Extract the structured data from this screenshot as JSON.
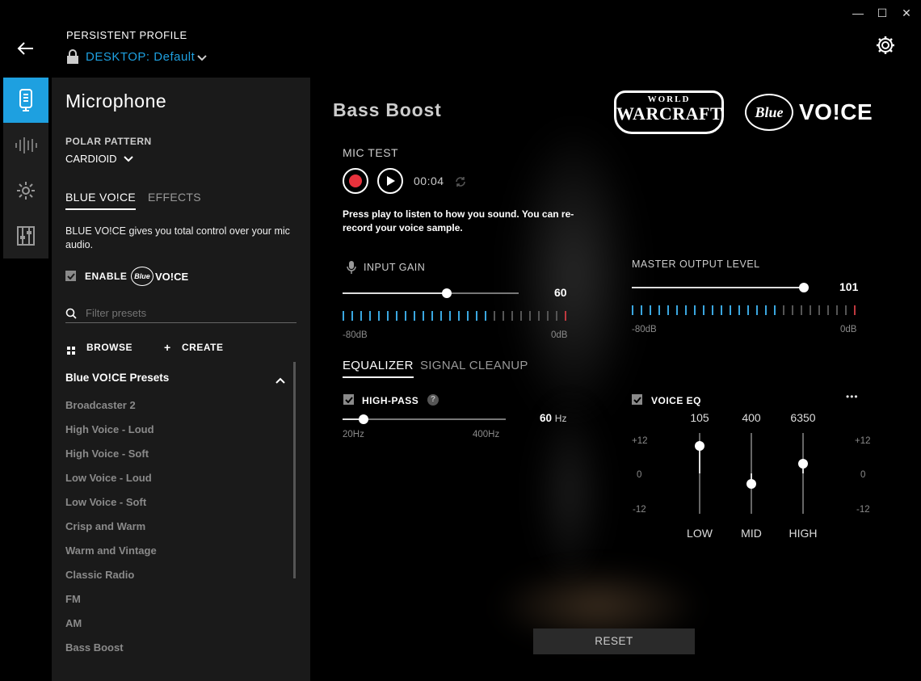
{
  "header": {
    "profile_label": "PERSISTENT PROFILE",
    "device": "DESKTOP:",
    "profile_name": "Default"
  },
  "window": {
    "minimize": "—",
    "maximize": "☐",
    "close": "✕"
  },
  "sidebar": {
    "title": "Microphone",
    "polar_label": "POLAR PATTERN",
    "polar_value": "CARDIOID",
    "tabs": [
      {
        "label": "BLUE VO!CE"
      },
      {
        "label": "EFFECTS"
      }
    ],
    "description": "BLUE VO!CE gives you total control over your mic audio.",
    "enable_label": "ENABLE",
    "enable_logo": "VO!CE",
    "filter_placeholder": "Filter presets",
    "browse_label": "BROWSE",
    "create_label": "CREATE",
    "presets_header": "Blue VO!CE Presets",
    "presets": [
      "Broadcaster 2",
      "High Voice - Loud",
      "High Voice - Soft",
      "Low Voice - Loud",
      "Low Voice - Soft",
      "Crisp and Warm",
      "Warm and Vintage",
      "Classic Radio",
      "FM",
      "AM",
      "Bass Boost"
    ]
  },
  "main": {
    "preset_title": "Bass Boost",
    "logos": {
      "game_top": "WORLD",
      "game_main": "WARCRAFT",
      "blue": "Blue",
      "voice": "VO!CE"
    },
    "mic_test": {
      "label": "MIC TEST",
      "time": "00:04",
      "hint": "Press play to listen to how you sound. You can re-record your voice sample."
    },
    "input_gain": {
      "label": "INPUT GAIN",
      "value": "60",
      "fraction": 0.6,
      "min": "-80dB",
      "max": "0dB"
    },
    "master_output": {
      "label": "MASTER OUTPUT LEVEL",
      "value": "101",
      "fraction": 1.0,
      "min": "-80dB",
      "max": "0dB"
    },
    "tabs": [
      {
        "label": "EQUALIZER"
      },
      {
        "label": "SIGNAL CLEANUP"
      }
    ],
    "high_pass": {
      "label": "HIGH-PASS",
      "help": "?",
      "value": "60",
      "unit": "Hz",
      "min": "20Hz",
      "max": "400Hz",
      "fraction": 0.1
    },
    "voice_eq": {
      "label": "VOICE EQ",
      "more": "•••",
      "scale_top": "+12",
      "scale_mid": "0",
      "scale_bottom": "-12",
      "bands": [
        {
          "freq": "105",
          "name": "LOW",
          "gain_fraction": 0.84
        },
        {
          "freq": "400",
          "name": "MID",
          "gain_fraction": 0.37
        },
        {
          "freq": "6350",
          "name": "HIGH",
          "gain_fraction": 0.62
        }
      ]
    },
    "reset_label": "RESET"
  },
  "colors": {
    "accent": "#1ea0e0",
    "record": "#e8323c",
    "panel": "#1a1a1a",
    "meter_on": "#3aa7e0",
    "meter_off": "#555555",
    "meter_peak": "#c0393f"
  }
}
